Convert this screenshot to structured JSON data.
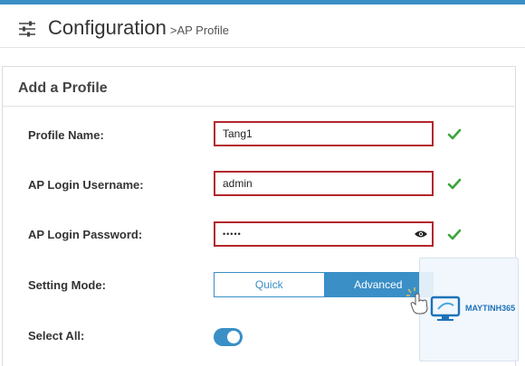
{
  "header": {
    "title": "Configuration",
    "breadcrumb": ">AP Profile",
    "icon": "sliders-icon"
  },
  "panel": {
    "title": "Add a Profile"
  },
  "form": {
    "profile_name": {
      "label": "Profile Name:",
      "value": "Tang1"
    },
    "login_username": {
      "label": "AP Login Username:",
      "value": "admin"
    },
    "login_password": {
      "label": "AP Login Password:",
      "value": "•••••"
    },
    "setting_mode": {
      "label": "Setting Mode:",
      "options": [
        "Quick",
        "Advanced"
      ],
      "selected": "Advanced"
    },
    "select_all": {
      "label": "Select All:",
      "enabled": true
    }
  },
  "colors": {
    "accent": "#3a8fc7",
    "error_border": "#b3272d",
    "valid_check": "#3aa53a"
  },
  "watermark": {
    "brand": "MAYTINH365"
  }
}
